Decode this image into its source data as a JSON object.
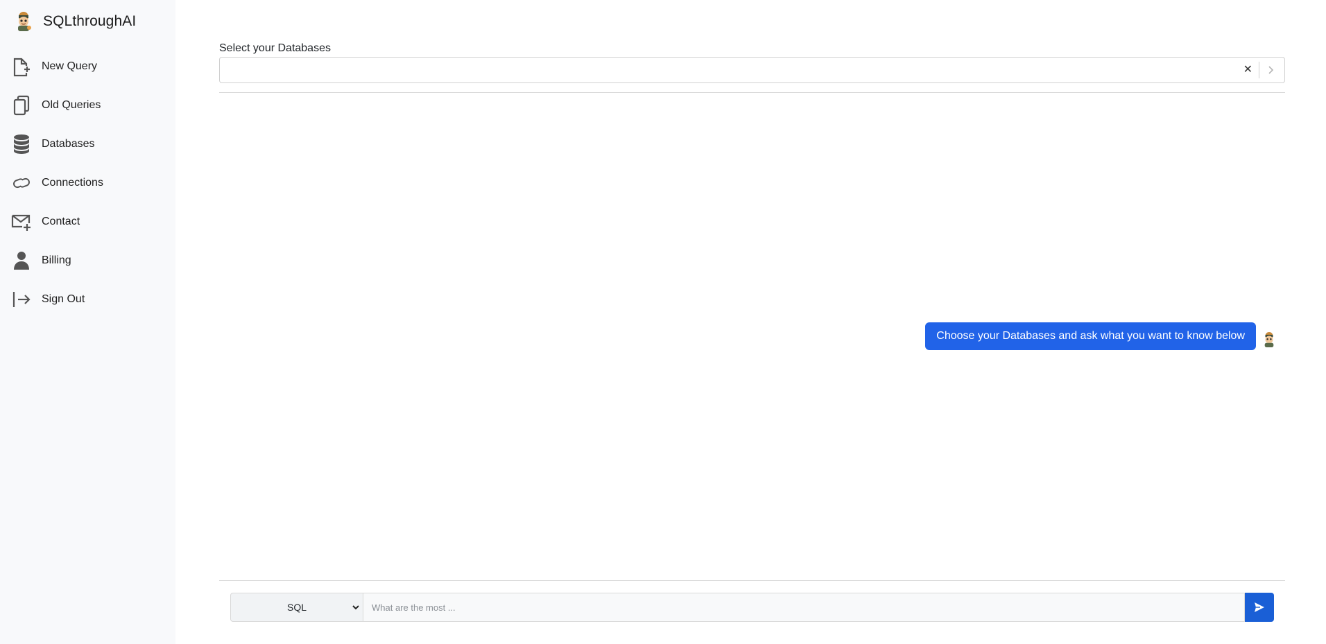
{
  "brand": {
    "title": "SQLthroughAI",
    "logo_icon": "mascot-avatar-icon"
  },
  "sidebar": {
    "items": [
      {
        "label": "New Query",
        "icon": "file-plus-icon"
      },
      {
        "label": "Old Queries",
        "icon": "files-icon"
      },
      {
        "label": "Databases",
        "icon": "database-icon"
      },
      {
        "label": "Connections",
        "icon": "link-icon"
      },
      {
        "label": "Contact",
        "icon": "envelope-plus-icon"
      },
      {
        "label": "Billing",
        "icon": "person-icon"
      },
      {
        "label": "Sign Out",
        "icon": "box-arrow-right-icon"
      }
    ]
  },
  "main": {
    "db_select_label": "Select your Databases",
    "db_select_clear": "✕",
    "message": "Choose your Databases and ask what you want to know below"
  },
  "composer": {
    "language_value": "SQL",
    "query_placeholder": "What are the most ...",
    "query_value": ""
  },
  "colors": {
    "sidebar_bg": "#f8f9fb",
    "accent": "#2163e8",
    "send_button": "#1a5fd6"
  }
}
